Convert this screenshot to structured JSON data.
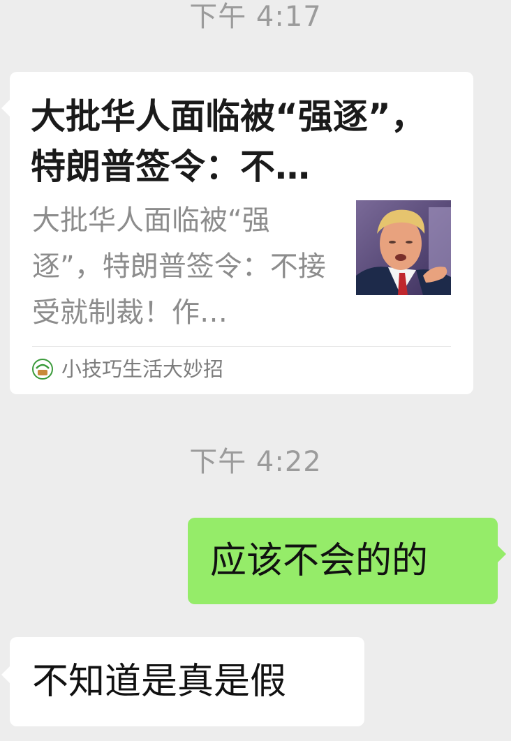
{
  "messages": [
    {
      "type": "timestamp",
      "text": "下午 4:17"
    },
    {
      "type": "link_card",
      "direction": "incoming",
      "title": "大批华人面临被“强逐”，特朗普签令：不…",
      "description": "大批华人面临被“强逐”，特朗普签令：不接受就制裁！作…",
      "thumbnail_icon": "trump-photo-thumbnail",
      "source_icon": "official-account-logo-icon",
      "source_name": "小技巧生活大妙招"
    },
    {
      "type": "timestamp",
      "text": "下午 4:22"
    },
    {
      "type": "text",
      "direction": "outgoing",
      "text": "应该不会的的",
      "bubble_color": "#95ec69"
    },
    {
      "type": "text",
      "direction": "incoming",
      "text": "不知道是真是假",
      "bubble_color": "#ffffff"
    }
  ],
  "colors": {
    "background": "#ededed",
    "outgoing_bubble": "#95ec69",
    "incoming_bubble": "#ffffff",
    "timestamp_text": "#9b9b9b"
  }
}
